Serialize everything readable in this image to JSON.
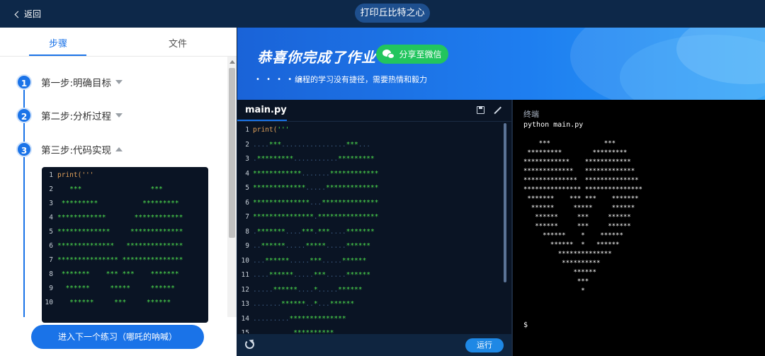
{
  "header": {
    "back_label": "返回",
    "title": "打印丘比特之心"
  },
  "left_panel": {
    "tabs": [
      {
        "label": "步骤",
        "active": true
      },
      {
        "label": "文件",
        "active": false
      }
    ],
    "steps": [
      {
        "num": "1",
        "label": "第一步:明确目标",
        "expanded": false
      },
      {
        "num": "2",
        "label": "第二步:分析过程",
        "expanded": false
      },
      {
        "num": "3",
        "label": "第三步:代码实现",
        "expanded": true
      }
    ],
    "mini_code": [
      {
        "ln": "1",
        "text": "print('''"
      },
      {
        "ln": "2",
        "text": "   ***                 ***"
      },
      {
        "ln": "3",
        "text": " *********           *********"
      },
      {
        "ln": "4",
        "text": "************       ************"
      },
      {
        "ln": "5",
        "text": "*************     *************"
      },
      {
        "ln": "6",
        "text": "**************   **************"
      },
      {
        "ln": "7",
        "text": "*************** ***************"
      },
      {
        "ln": "8",
        "text": " *******    *** ***    *******"
      },
      {
        "ln": "9",
        "text": "  ******     *****     ******"
      },
      {
        "ln": "10",
        "text": "   ******     ***     ******"
      }
    ],
    "next_button": "进入下一个练习（哪吒的呐喊）"
  },
  "banner": {
    "congrats": "恭喜你完成了作业",
    "share_button": "分享至微信",
    "motto_dots": "• • • • •",
    "motto": "编程的学习没有捷径，需要热情和毅力"
  },
  "editor": {
    "file_tab": "main.py",
    "run_button": "运行",
    "lines": [
      {
        "ln": "1",
        "segments": [
          {
            "t": "kw",
            "s": "print("
          },
          {
            "t": "str",
            "s": "'''"
          }
        ]
      },
      {
        "ln": "2",
        "segments": [
          {
            "t": "dot",
            "s": "...."
          },
          {
            "t": "str",
            "s": "***"
          },
          {
            "t": "dot",
            "s": "................"
          },
          {
            "t": "str",
            "s": "***"
          },
          {
            "t": "dot",
            "s": "..."
          }
        ]
      },
      {
        "ln": "3",
        "segments": [
          {
            "t": "dot",
            "s": "."
          },
          {
            "t": "str",
            "s": "*********"
          },
          {
            "t": "dot",
            "s": "..........."
          },
          {
            "t": "str",
            "s": "*********"
          }
        ]
      },
      {
        "ln": "4",
        "segments": [
          {
            "t": "str",
            "s": "************"
          },
          {
            "t": "dot",
            "s": "......."
          },
          {
            "t": "str",
            "s": "************"
          }
        ]
      },
      {
        "ln": "5",
        "segments": [
          {
            "t": "str",
            "s": "*************"
          },
          {
            "t": "dot",
            "s": "....."
          },
          {
            "t": "str",
            "s": "*************"
          }
        ]
      },
      {
        "ln": "6",
        "segments": [
          {
            "t": "str",
            "s": "**************"
          },
          {
            "t": "dot",
            "s": "..."
          },
          {
            "t": "str",
            "s": "**************"
          }
        ]
      },
      {
        "ln": "7",
        "segments": [
          {
            "t": "str",
            "s": "***************"
          },
          {
            "t": "dot",
            "s": "."
          },
          {
            "t": "str",
            "s": "***************"
          }
        ]
      },
      {
        "ln": "8",
        "segments": [
          {
            "t": "dot",
            "s": "."
          },
          {
            "t": "str",
            "s": "*******"
          },
          {
            "t": "dot",
            "s": "...."
          },
          {
            "t": "str",
            "s": "***"
          },
          {
            "t": "dot",
            "s": "."
          },
          {
            "t": "str",
            "s": "***"
          },
          {
            "t": "dot",
            "s": "...."
          },
          {
            "t": "str",
            "s": "*******"
          }
        ]
      },
      {
        "ln": "9",
        "segments": [
          {
            "t": "dot",
            "s": ".."
          },
          {
            "t": "str",
            "s": "******"
          },
          {
            "t": "dot",
            "s": "....."
          },
          {
            "t": "str",
            "s": "*****"
          },
          {
            "t": "dot",
            "s": "....."
          },
          {
            "t": "str",
            "s": "******"
          }
        ]
      },
      {
        "ln": "10",
        "segments": [
          {
            "t": "dot",
            "s": "..."
          },
          {
            "t": "str",
            "s": "******"
          },
          {
            "t": "dot",
            "s": "....."
          },
          {
            "t": "str",
            "s": "***"
          },
          {
            "t": "dot",
            "s": "....."
          },
          {
            "t": "str",
            "s": "******"
          }
        ]
      },
      {
        "ln": "11",
        "segments": [
          {
            "t": "dot",
            "s": "...."
          },
          {
            "t": "str",
            "s": "******"
          },
          {
            "t": "dot",
            "s": "....."
          },
          {
            "t": "str",
            "s": "***"
          },
          {
            "t": "dot",
            "s": "....."
          },
          {
            "t": "str",
            "s": "******"
          }
        ]
      },
      {
        "ln": "12",
        "segments": [
          {
            "t": "dot",
            "s": "....."
          },
          {
            "t": "str",
            "s": "******"
          },
          {
            "t": "dot",
            "s": "...."
          },
          {
            "t": "str",
            "s": "*"
          },
          {
            "t": "dot",
            "s": "....."
          },
          {
            "t": "str",
            "s": "******"
          }
        ]
      },
      {
        "ln": "13",
        "segments": [
          {
            "t": "dot",
            "s": "......."
          },
          {
            "t": "str",
            "s": "******"
          },
          {
            "t": "dot",
            "s": ".."
          },
          {
            "t": "str",
            "s": "*"
          },
          {
            "t": "dot",
            "s": "..."
          },
          {
            "t": "str",
            "s": "******"
          }
        ]
      },
      {
        "ln": "14",
        "segments": [
          {
            "t": "dot",
            "s": "........."
          },
          {
            "t": "str",
            "s": "**************"
          }
        ]
      },
      {
        "ln": "15",
        "segments": [
          {
            "t": "dot",
            "s": ".........."
          },
          {
            "t": "str",
            "s": "**********"
          }
        ]
      }
    ]
  },
  "terminal": {
    "title": "终端",
    "command": "python main.py",
    "output": "    ***              ***\n *********        *********\n************    ************\n*************   *************\n**************  **************\n*************** ***************\n *******    *** ***    *******\n  ******     *****     ******\n   ******     ***     ******\n   ******     ***     ******\n     ******    *    ******\n       ******  *   ******\n         **************\n          **********\n             ******\n              ***\n               *",
    "prompt": "$"
  },
  "colors": {
    "accent": "#1a73e8",
    "header_bg": "#0d2849",
    "share_green": "#22c55e",
    "code_green": "#4ee04e"
  }
}
